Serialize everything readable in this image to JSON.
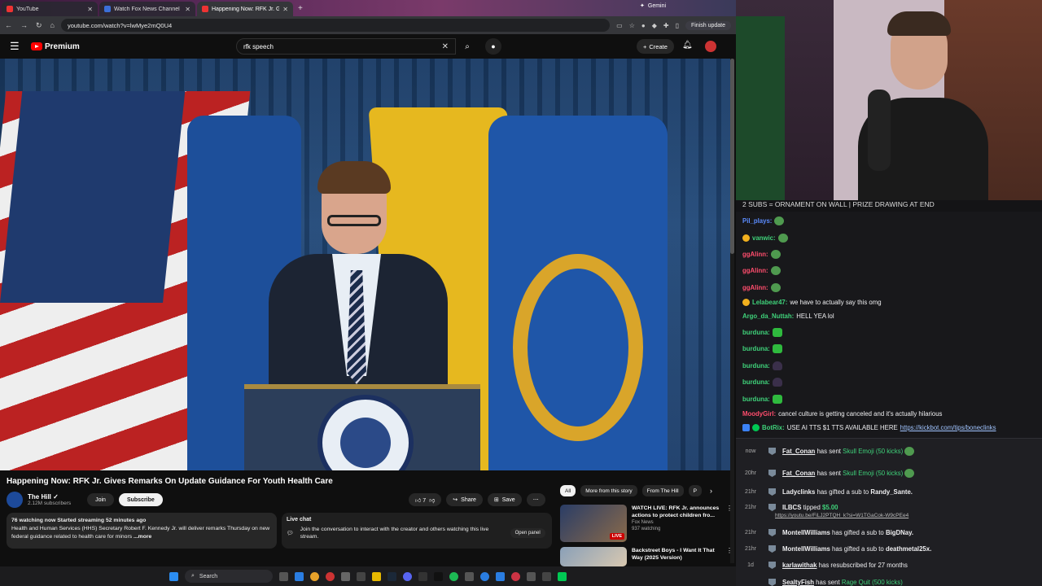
{
  "browser": {
    "tabs": [
      {
        "label": "YouTube",
        "favicon": "youtube-icon"
      },
      {
        "label": "Watch Fox News Channel",
        "favicon": "fox-icon"
      },
      {
        "label": "Happening Now: RFK Jr. Gi",
        "favicon": "youtube-icon"
      }
    ],
    "gemini_tab": "Gemini",
    "url": "youtube.com/watch?v=lwMye2mQ0U4",
    "finish_update": "Finish update"
  },
  "youtube": {
    "logo_text": "Premium",
    "search_value": "rfk speech",
    "create_label": "Create"
  },
  "video": {
    "title": "Happening Now: RFK Jr. Gives Remarks On Update Guidance For Youth Health Care",
    "channel_name": "The Hill",
    "subscribers": "2.12M subscribers",
    "join_label": "Join",
    "subscribe_label": "Subscribe",
    "likes": "7",
    "share_label": "Share",
    "save_label": "Save",
    "description_meta": "76 watching now  Started streaming 52 minutes ago",
    "description_text": "Health and Human Services (HHS) Secretary Robert F. Kennedy Jr. will deliver remarks Thursday on new federal guidance related to health care for minors",
    "description_more": "...more"
  },
  "livechat": {
    "title": "Live chat",
    "text": "Join the conversation to interact with the creator and others watching this live stream.",
    "open_panel": "Open panel"
  },
  "chips": [
    "All",
    "More from this story",
    "From The Hill",
    "P"
  ],
  "recommendations": [
    {
      "title": "WATCH LIVE: RFK Jr. announces actions to protect children fro...",
      "channel": "Fox News",
      "meta": "937 watching",
      "badge": "LIVE"
    },
    {
      "title": "Backstreet Boys - I Want It That Way (2025 Version)",
      "channel": "",
      "meta": "",
      "badge": ""
    }
  ],
  "stream_chat": {
    "banner": "2 SUBS = ORNAMENT ON WALL | PRIZE DRAWING AT END",
    "messages": [
      {
        "user": "Pil_plays:",
        "color": "#5b8cff",
        "text": "",
        "emote": "frog"
      },
      {
        "user": "vanwic:",
        "color": "#3fd27a",
        "text": "",
        "emote": "frog"
      },
      {
        "user": "ggAlinn:",
        "color": "#ff4d6d",
        "text": "",
        "emote": "frog"
      },
      {
        "user": "ggAlinn:",
        "color": "#ff4d6d",
        "text": "",
        "emote": "frog"
      },
      {
        "user": "ggAlinn:",
        "color": "#ff4d6d",
        "text": "",
        "emote": "frog"
      },
      {
        "user": "Lelabear47:",
        "color": "#3fd27a",
        "text": "we have to actually say this omg",
        "emote": ""
      },
      {
        "user": "Argo_da_Nuttah:",
        "color": "#3fd27a",
        "text": "HELL YEA lol",
        "emote": ""
      },
      {
        "user": "burduna:",
        "color": "#3fd27a",
        "text": "",
        "emote": "cup"
      },
      {
        "user": "burduna:",
        "color": "#3fd27a",
        "text": "",
        "emote": "cup"
      },
      {
        "user": "burduna:",
        "color": "#3fd27a",
        "text": "",
        "emote": "dark"
      },
      {
        "user": "burduna:",
        "color": "#3fd27a",
        "text": "",
        "emote": "dark"
      },
      {
        "user": "burduna:",
        "color": "#3fd27a",
        "text": "",
        "emote": "cup"
      },
      {
        "user": "MoodyGirl:",
        "color": "#ff4d6d",
        "text": "cancel culture is getting canceled and it's actually hilarious",
        "emote": ""
      },
      {
        "user": "BotRix:",
        "color": "#3fd27a",
        "text": "USE AI TTS $1 TTS AVAILABLE HERE",
        "emote": "",
        "link": "https://kickbot.com/tips/boneclinks"
      }
    ],
    "events": [
      {
        "time": "now",
        "user": "Fat_Conan",
        "mid": "has sent",
        "gift": "Skull Emoji (50 kicks)"
      },
      {
        "time": "20hr",
        "user": "Fat_Conan",
        "mid": "has sent",
        "gift": "Skull Emoji (50 kicks)"
      },
      {
        "time": "21hr",
        "user": "Ladyclinks",
        "mid": "has gifted a sub to",
        "target": "Randy_Sante."
      },
      {
        "time": "21hr",
        "user": "ILBCS",
        "mid": "tipped",
        "amount": "$5.00",
        "link": "https://youtu.be/FiLJ2PTQH_k?si=W1TGaCok-W9cPEe4"
      },
      {
        "time": "21hr",
        "user": "MontellWilliams",
        "mid": "has gifted a sub to",
        "target": "BigDNay."
      },
      {
        "time": "21hr",
        "user": "MontellWilliams",
        "mid": "has gifted a sub to",
        "target": "deathmetal25x."
      },
      {
        "time": "1d",
        "user": "karlawithak",
        "mid": "has resubscribed for 27 months"
      },
      {
        "time": "",
        "user": "SealtyFish",
        "mid": "has sent",
        "gift": "Rage Quit (500 kicks)"
      }
    ]
  },
  "taskbar": {
    "search_label": "Search"
  }
}
